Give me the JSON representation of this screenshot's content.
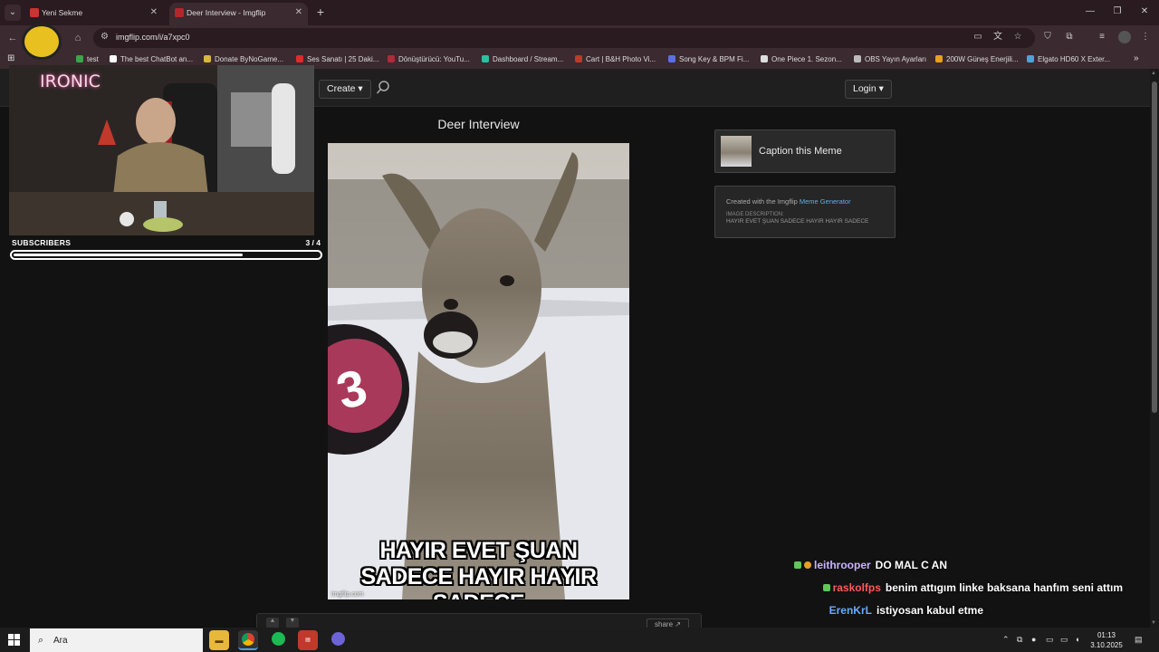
{
  "browser": {
    "tabs": [
      {
        "title": "Yeni Sekme",
        "active": false
      },
      {
        "title": "Deer Interview - Imgflip",
        "active": true
      }
    ],
    "url": "imgflip.com/i/a7xpc0",
    "bookmarks": [
      {
        "label": "test",
        "color": "#3ea34a"
      },
      {
        "label": "The best ChatBot an...",
        "color": "#ffffff"
      },
      {
        "label": "Donate ByNoGame...",
        "color": "#d8b840"
      },
      {
        "label": "Ses Sanatı | 25 Daki...",
        "color": "#e02b2b"
      },
      {
        "label": "Dönüştürücü: YouTu...",
        "color": "#b02a3a"
      },
      {
        "label": "Dashboard / Stream...",
        "color": "#2fbfa0"
      },
      {
        "label": "Cart | B&H Photo Vi...",
        "color": "#c0392b"
      },
      {
        "label": "Song Key & BPM Fi...",
        "color": "#5d6fe0"
      },
      {
        "label": "One Piece 1. Sezon...",
        "color": "#dddddd"
      },
      {
        "label": "OBS Yayın Ayarları",
        "color": "#bbbbbb"
      },
      {
        "label": "200W Güneş Enerjili...",
        "color": "#e8a020"
      },
      {
        "label": "Elgato HD60 X Exter...",
        "color": "#4aa3e0"
      }
    ]
  },
  "site": {
    "create_label": "Create",
    "login_label": "Login"
  },
  "meme": {
    "title": "Deer Interview",
    "caption_line1": "HAYIR EVET ŞUAN",
    "caption_line2": "SADECE HAYIR HAYIR SADECE",
    "watermark": "imgflip.com",
    "share_label": "share"
  },
  "sidebar": {
    "caption_label": "Caption this Meme",
    "created_prefix": "Created with the Imgflip",
    "created_link": "Meme Generator",
    "desc_heading": "IMAGE DESCRIPTION:",
    "desc_text": "HAYIR EVET ŞUAN SADECE HAYIR HAYIR SADECE"
  },
  "stream": {
    "cam_sign": "IRONIC",
    "subs_label": "SUBSCRIBERS",
    "subs_count": "3 / 4",
    "subs_progress": 0.75,
    "chat": [
      {
        "user": "leithrooper",
        "color": "#c9b2ff",
        "text": "DO MAL C AN"
      },
      {
        "user": "raskolfps",
        "color": "#ff5a5a",
        "text": "benim attıgım linke baksana hanfım seni attım"
      },
      {
        "user": "ErenKrL",
        "color": "#6aa8ff",
        "text": "istiyosan kabul etme"
      }
    ]
  },
  "taskbar": {
    "search_placeholder": "Ara",
    "time": "01:13",
    "date": "3.10.2025"
  }
}
